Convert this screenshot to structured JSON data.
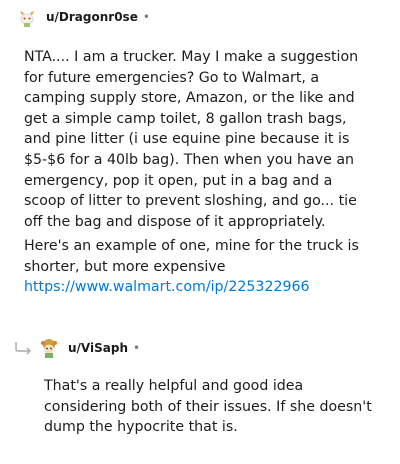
{
  "comment": {
    "username": "u/Dragonr0se",
    "separator": "•",
    "avatar_icon": "snoo-avatar-icon",
    "paragraphs": [
      "NTA.... I am a trucker. May I make a suggestion for future emergencies? Go to Walmart, a camping supply store, Amazon, or the like and get a simple camp toilet, 8 gallon trash bags, and pine litter (i use equine pine because it is $5-$6 for a 40lb bag). Then when you have an emergency, pop it open, put in a bag and a scoop of litter to prevent sloshing, and go... tie off the bag and dispose of it appropriately.",
      "Here's an example of one, mine for the truck is shorter, but more expensive"
    ],
    "link": "https://www.walmart.com/ip/225322966"
  },
  "reply": {
    "username": "u/ViSaph",
    "separator": "•",
    "avatar_icon": "snoo-avatar-icon",
    "reply_icon": "reply-arrow-icon",
    "text": "That's a really helpful and good idea considering both of their issues. If she doesn't dump the hypocrite that is."
  },
  "colors": {
    "link": "#0079d3",
    "text": "#1c1c1c",
    "muted": "#7c7c7c"
  }
}
